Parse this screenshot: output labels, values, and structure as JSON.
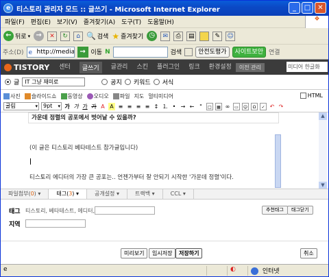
{
  "window": {
    "title": "티스토리 관리자 모드 :: 글쓰기 - Microsoft Internet Explorer"
  },
  "menu": [
    "파일(F)",
    "편집(E)",
    "보기(V)",
    "즐겨찾기(A)",
    "도구(T)",
    "도움말(H)"
  ],
  "toolbar": {
    "back": "뒤로",
    "search": "검색",
    "favorites": "즐겨찾기"
  },
  "address": {
    "label": "주소(D)",
    "url": "http://media.har",
    "go": "이동",
    "search_btn": "검색",
    "antivirus": "안전도평가",
    "siteblock": "사이트보안",
    "links": "연결"
  },
  "tistory": {
    "logo": "TISTORY",
    "nav": [
      "센터",
      "글쓰기",
      "글관리",
      "스킨",
      "플러그인",
      "링크",
      "환경설정"
    ],
    "active": "글쓰기",
    "blogmgr": "이전 관리",
    "search_value": "미디어 한글화"
  },
  "post": {
    "type_selected": "글",
    "title": "IT 그냥 재미로",
    "visibility": [
      "공지",
      "키워드",
      "서식"
    ]
  },
  "attach": {
    "items": [
      "사진",
      "슬라이드쇼",
      "동영상",
      "오디오",
      "파일",
      "지도",
      "멀티미디어"
    ],
    "html": "HTML"
  },
  "format": {
    "font": "굴림",
    "size": "9pt",
    "bold": "가",
    "italic": "가",
    "underline": "가",
    "strike": "가"
  },
  "editor": {
    "heading": "가운데 정렬의 공포에서 벗어날 수 있을까?",
    "line1": "(이 글은 티스토리 베타테스트 참가글입니다)",
    "line2": "티스토리 에디터의 가장 큰 공포는.. 언젠가부터 잘 안되기 시작한 '가운데 정렬'이다."
  },
  "tabs": [
    {
      "label": "파일첨부(",
      "count": "0",
      "close": ")"
    },
    {
      "label": "태그(",
      "count": "3",
      "close": ")"
    },
    {
      "label": "공개설정"
    },
    {
      "label": "트랙백"
    },
    {
      "label": "CCL"
    }
  ],
  "tag": {
    "label": "태그",
    "value": "티스토리, 베타테스트, 에디터,",
    "recommend": "추천태그",
    "close": "태그닫기",
    "location_label": "지역"
  },
  "buttons": {
    "preview": "미리보기",
    "temp": "임시저장",
    "save": "저장하기",
    "cancel": "취소"
  },
  "status": {
    "zone": "인터넷"
  }
}
